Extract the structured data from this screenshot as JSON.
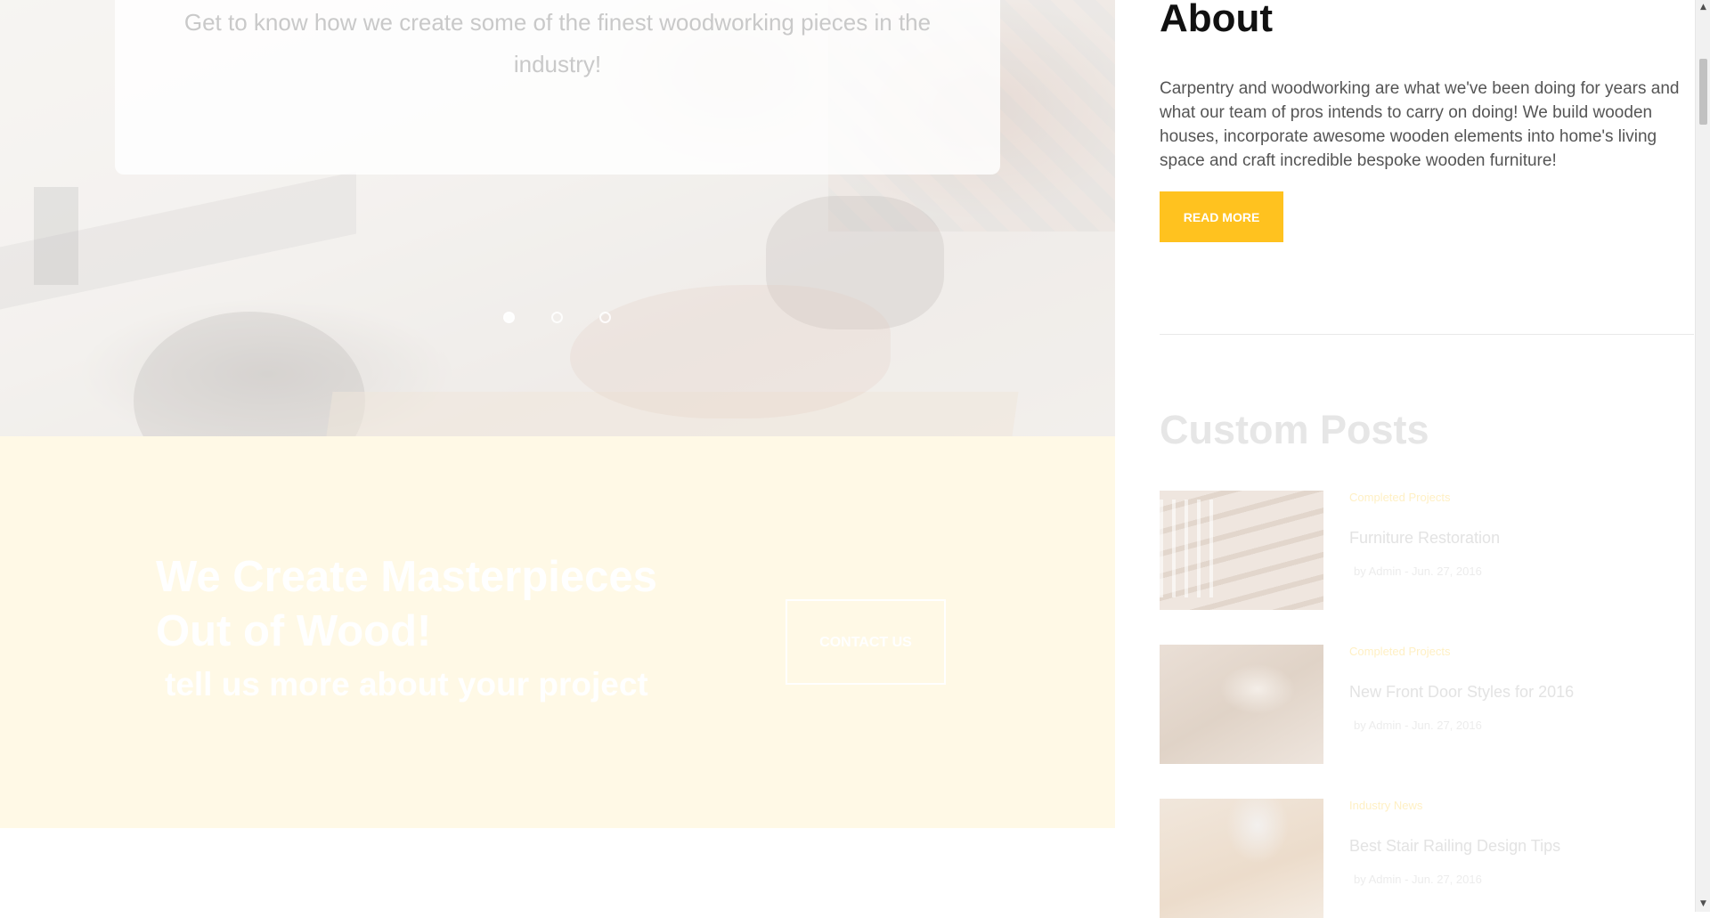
{
  "hero": {
    "text": "Get to know how we create some of the finest woodworking pieces in the industry!",
    "slides": 3,
    "active_slide": 1
  },
  "cta": {
    "title": "We Create Masterpieces Out of Wood!",
    "subtitle": "tell us more about your project",
    "button": "CONTACT US"
  },
  "sidebar": {
    "about_title": "About",
    "about_text": "Carpentry and woodworking are what we've been doing for years and what our team of pros intends to carry on doing! We build wooden houses, incorporate awesome wooden elements into home's living space and craft incredible bespoke wooden furniture!",
    "read_more": "READ MORE",
    "posts_title": "Custom Posts",
    "posts": [
      {
        "category": "Completed Projects",
        "title": "Furniture Restoration",
        "meta": "by Admin - Jun. 27, 2016"
      },
      {
        "category": "Completed Projects",
        "title": "New Front Door Styles for 2016",
        "meta": "by Admin - Jun. 27, 2016"
      },
      {
        "category": "Industry News",
        "title": "Best Stair Railing Design Tips",
        "meta": "by Admin - Jun. 27, 2016"
      }
    ]
  },
  "scrollbar": {
    "up_icon": "▲",
    "down_icon": "▼"
  },
  "colors": {
    "accent": "#ffc21f",
    "cta_background": "#fff9e6"
  }
}
